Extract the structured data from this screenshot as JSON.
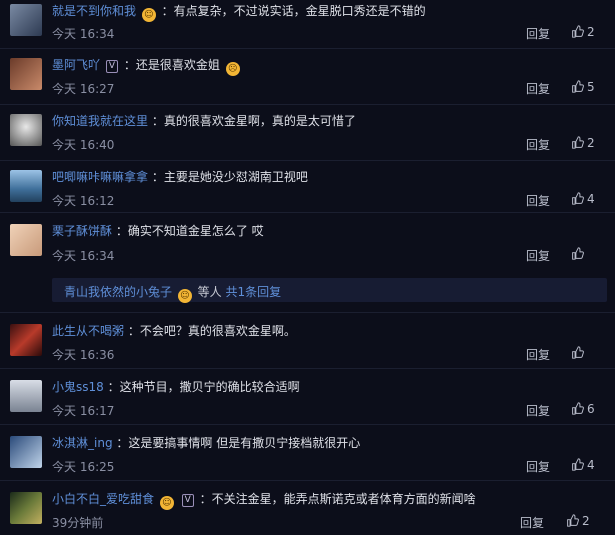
{
  "comments": [
    {
      "user": "就是不到你和我",
      "badge": "",
      "emoji": true,
      "text": "：有点复杂，不过说实话，金星脱口秀还是不错的",
      "time": "今天 16:34",
      "reply": "回复",
      "likes": "2"
    },
    {
      "user": "墨阿飞吖",
      "badge": "V",
      "emoji": false,
      "text": "：还是很喜欢金姐",
      "emoji_after": true,
      "time": "今天 16:27",
      "reply": "回复",
      "likes": "5"
    },
    {
      "user": "你知道我就在这里",
      "badge": "",
      "emoji": false,
      "text": "：真的很喜欢金星啊，真的是太可惜了",
      "time": "今天 16:40",
      "reply": "回复",
      "likes": "2"
    },
    {
      "user": "吧唧嘛咔嘛嘛拿拿",
      "badge": "",
      "emoji": false,
      "text": "：主要是她没少怼湖南卫视吧",
      "time": "今天 16:12",
      "reply": "回复",
      "likes": "4"
    },
    {
      "user": "栗子酥饼酥",
      "badge": "",
      "emoji": false,
      "text": "：确实不知道金星怎么了 哎",
      "time": "今天 16:34",
      "reply": "回复",
      "likes": ""
    },
    {
      "user": "此生从不喝粥",
      "badge": "",
      "emoji": false,
      "text": "：不会吧？真的很喜欢金星啊。",
      "time": "今天 16:36",
      "reply": "回复",
      "likes": ""
    },
    {
      "user": "小鬼ss18",
      "badge": "",
      "emoji": false,
      "text": "：这种节目，撒贝宁的确比较合适啊",
      "time": "今天 16:17",
      "reply": "回复",
      "likes": "6"
    },
    {
      "user": "冰淇淋_ing",
      "badge": "",
      "emoji": false,
      "text": "：这是要搞事情啊 但是有撒贝宁接档就很开心",
      "time": "今天 16:25",
      "reply": "回复",
      "likes": "4"
    },
    {
      "user": "小白不白_爱吃甜食",
      "badge": "V",
      "emoji": true,
      "text": "：不关注金星，能弄点斯诺克或者体育方面的新闻啥",
      "time": "39分钟前",
      "reply": "回复",
      "likes": "2"
    }
  ],
  "subreply": {
    "user": "青山我依然的小兔子",
    "emoji": true,
    "mid": " 等人 ",
    "link": "共1条回复"
  },
  "colors": {
    "bg": "#0c0e1a",
    "username": "#5f8fd8",
    "subreply_bg": "#171c33"
  }
}
